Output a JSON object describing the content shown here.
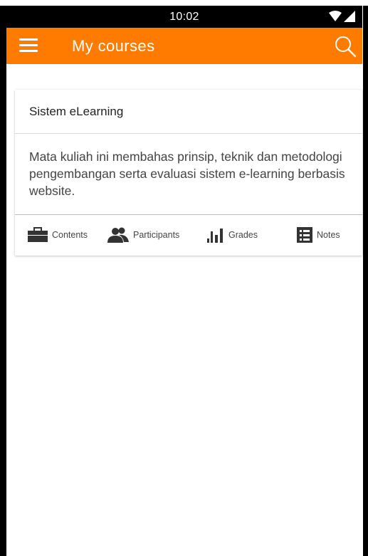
{
  "status_bar": {
    "time": "10:02",
    "icons": [
      "wifi-icon",
      "signal-icon"
    ]
  },
  "app_bar": {
    "title": "My courses",
    "menu_icon": "hamburger-menu-icon",
    "search_icon": "search-icon"
  },
  "course": {
    "title": "Sistem eLearning",
    "summary": "Mata kuliah ini membahas prinsip, teknik dan metodologi pengembangan serta evaluasi sistem e-learning berbasis website.",
    "actions": [
      {
        "label": "Contents",
        "icon": "briefcase-icon"
      },
      {
        "label": "Participants",
        "icon": "people-icon"
      },
      {
        "label": "Grades",
        "icon": "bar-chart-icon"
      },
      {
        "label": "Notes",
        "icon": "list-icon"
      }
    ]
  },
  "colors": {
    "accent": "#ff7b00",
    "status_bar": "#000000",
    "text": "#444444"
  }
}
